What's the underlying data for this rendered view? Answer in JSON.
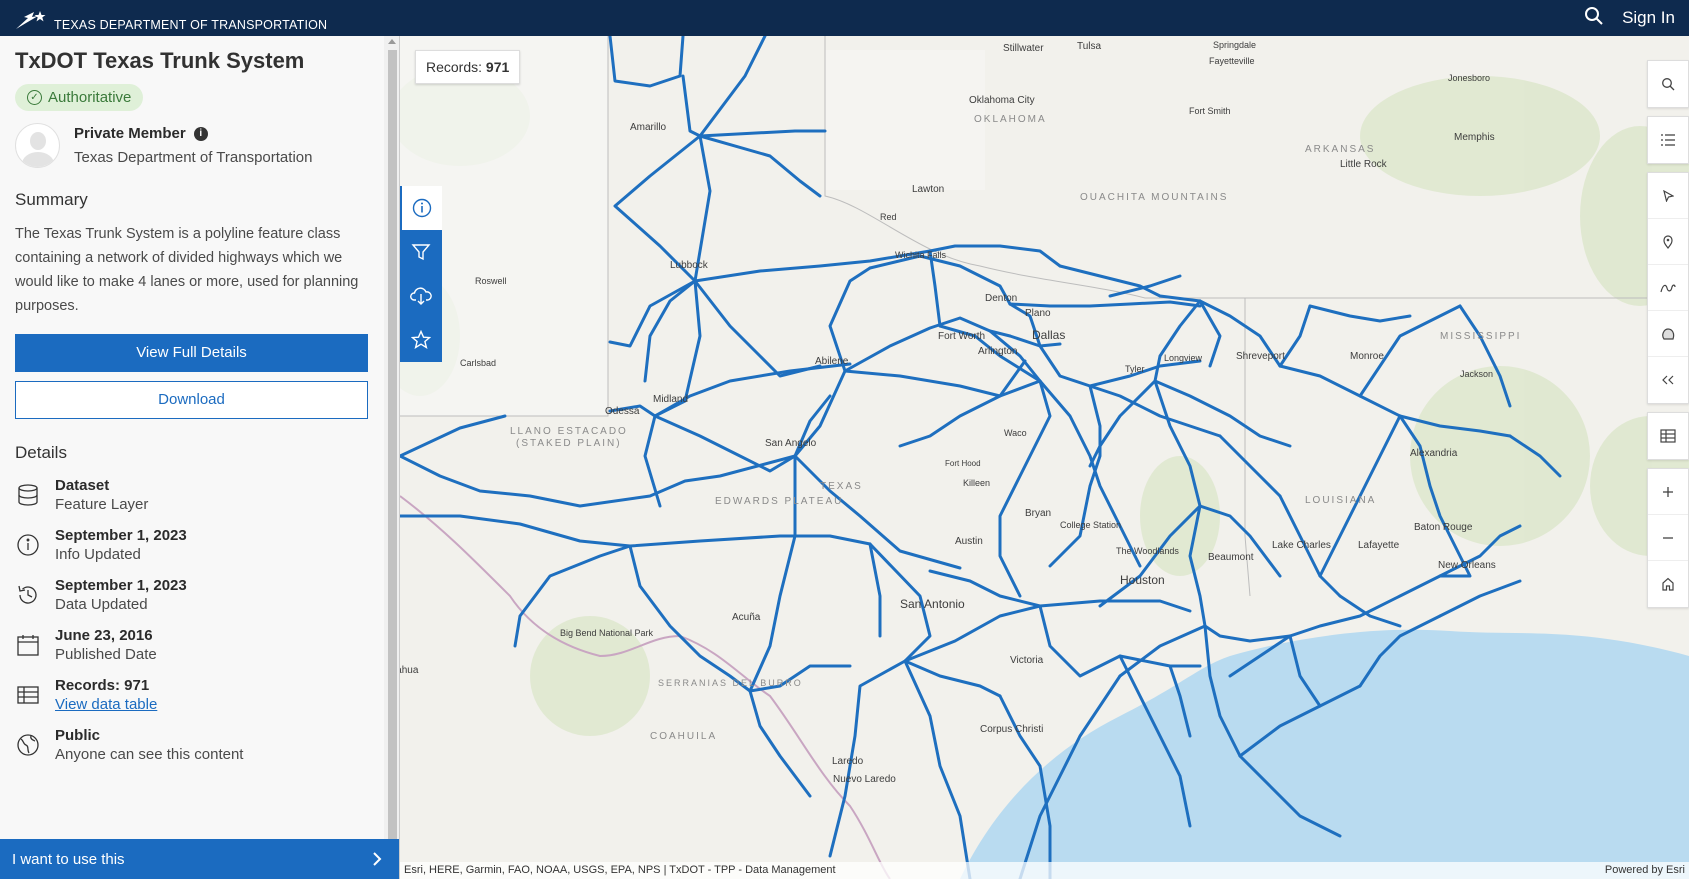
{
  "header": {
    "agency": "TEXAS DEPARTMENT OF TRANSPORTATION",
    "sign_in": "Sign In"
  },
  "item": {
    "title": "TxDOT Texas Trunk System",
    "badge": "Authoritative",
    "owner_name": "Private Member",
    "owner_org": "Texas Department of Transportation",
    "summary_heading": "Summary",
    "summary": "The Texas Trunk System is a polyline feature class containing a network of divided highways which we would like to make 4 lanes or more, used for planning purposes.",
    "view_details": "View Full Details",
    "download": "Download",
    "details_heading": "Details"
  },
  "details": [
    {
      "title": "Dataset",
      "sub": "Feature Layer",
      "icon": "database-icon"
    },
    {
      "title": "September 1, 2023",
      "sub": "Info Updated",
      "icon": "info-icon"
    },
    {
      "title": "September 1, 2023",
      "sub": "Data Updated",
      "icon": "history-icon"
    },
    {
      "title": "June 23, 2016",
      "sub": "Published Date",
      "icon": "calendar-icon"
    },
    {
      "title": "Records: 971",
      "link": "View data table",
      "icon": "table-icon"
    },
    {
      "title": "Public",
      "sub": "Anyone can see this content",
      "icon": "globe-icon"
    }
  ],
  "cta": "I want to use this",
  "map": {
    "records_label": "Records:",
    "records_value": "971",
    "attribution": "Esri, HERE, Garmin, FAO, NOAA, USGS, EPA, NPS | TxDOT - TPP - Data Management",
    "powered_by": "Powered by Esri",
    "labels": [
      {
        "t": "Amarillo"
      },
      {
        "t": "Lubbock"
      },
      {
        "t": "Roswell"
      },
      {
        "t": "Carlsbad"
      },
      {
        "t": "Odessa"
      },
      {
        "t": "Midland"
      },
      {
        "t": "Abilene"
      },
      {
        "t": "San Angelo"
      },
      {
        "t": "Wichita Falls"
      },
      {
        "t": "Denton"
      },
      {
        "t": "Plano"
      },
      {
        "t": "Dallas"
      },
      {
        "t": "Fort Worth"
      },
      {
        "t": "Arlington"
      },
      {
        "t": "Longview"
      },
      {
        "t": "Tyler"
      },
      {
        "t": "Shreveport"
      },
      {
        "t": "Monroe"
      },
      {
        "t": "Jackson"
      },
      {
        "t": "Waco"
      },
      {
        "t": "Killeen"
      },
      {
        "t": "Fort Hood"
      },
      {
        "t": "Bryan"
      },
      {
        "t": "College Station"
      },
      {
        "t": "Austin"
      },
      {
        "t": "San Antonio"
      },
      {
        "t": "Houston"
      },
      {
        "t": "The Woodlands"
      },
      {
        "t": "Beaumont"
      },
      {
        "t": "Lake Charles"
      },
      {
        "t": "Lafayette"
      },
      {
        "t": "Baton Rouge"
      },
      {
        "t": "New Orleans"
      },
      {
        "t": "Alexandria"
      },
      {
        "t": "Victoria"
      },
      {
        "t": "Corpus Christi"
      },
      {
        "t": "Laredo"
      },
      {
        "t": "Nuevo Laredo"
      },
      {
        "t": "Acuña"
      },
      {
        "t": "Chihuahua"
      },
      {
        "t": "Lawton"
      },
      {
        "t": "Oklahoma City"
      },
      {
        "t": "Tulsa"
      },
      {
        "t": "Stillwater"
      },
      {
        "t": "Springdale"
      },
      {
        "t": "Fayetteville"
      },
      {
        "t": "Fort Smith"
      },
      {
        "t": "Little Rock"
      },
      {
        "t": "Memphis"
      },
      {
        "t": "Jonesboro"
      },
      {
        "t": "TEXAS"
      },
      {
        "t": "OKLAHOMA"
      },
      {
        "t": "ARKANSAS"
      },
      {
        "t": "LOUISIANA"
      },
      {
        "t": "MISSISSIPPI"
      },
      {
        "t": "EDWARDS PLATEAU"
      },
      {
        "t": "LLANO ESTACADO"
      },
      {
        "t": "(STAKED PLAIN)"
      },
      {
        "t": "OUACHITA MOUNTAINS"
      },
      {
        "t": "COAHUILA"
      },
      {
        "t": "SERRANIAS DEL BURRO"
      },
      {
        "t": "Big Bend National Park"
      },
      {
        "t": "Red"
      }
    ]
  }
}
